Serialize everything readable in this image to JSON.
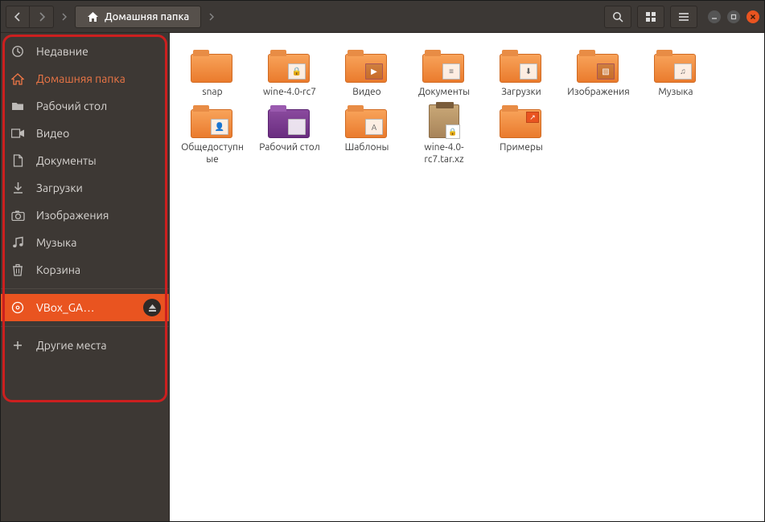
{
  "header": {
    "path_label": "Домашняя папка"
  },
  "sidebar": {
    "items": [
      {
        "icon": "clock",
        "label": "Недавние"
      },
      {
        "icon": "home",
        "label": "Домашняя папка",
        "active": true
      },
      {
        "icon": "folder",
        "label": "Рабочий стол"
      },
      {
        "icon": "video",
        "label": "Видео"
      },
      {
        "icon": "doc",
        "label": "Документы"
      },
      {
        "icon": "download",
        "label": "Загрузки"
      },
      {
        "icon": "camera",
        "label": "Изображения"
      },
      {
        "icon": "music",
        "label": "Музыка"
      },
      {
        "icon": "trash",
        "label": "Корзина"
      }
    ],
    "devices": [
      {
        "icon": "disc",
        "label": "VBox_GA…",
        "selected": true,
        "ejectable": true
      }
    ],
    "other": [
      {
        "icon": "plus",
        "label": "Другие места"
      }
    ]
  },
  "content": {
    "row1": [
      {
        "type": "folder",
        "label": "snap"
      },
      {
        "type": "folder",
        "label": "wine-4.0-rc7",
        "emblem": "lock"
      },
      {
        "type": "folder",
        "label": "Видео",
        "emblem": "video",
        "dark": true
      },
      {
        "type": "folder",
        "label": "Документы",
        "emblem": "doc"
      },
      {
        "type": "folder",
        "label": "Загрузки",
        "emblem": "download"
      },
      {
        "type": "folder",
        "label": "Изображения",
        "emblem": "image",
        "dark": true
      },
      {
        "type": "folder",
        "label": "Музыка",
        "emblem": "music"
      }
    ],
    "row2": [
      {
        "type": "folder",
        "label": "Общедоступные",
        "emblem": "person"
      },
      {
        "type": "folder",
        "label": "Рабочий стол",
        "purple": true,
        "emblem": "blank"
      },
      {
        "type": "folder",
        "label": "Шаблоны",
        "emblem": "template"
      },
      {
        "type": "archive",
        "label": "wine-4.0-rc7.tar.xz",
        "emblem": "lock"
      },
      {
        "type": "folder",
        "label": "Примеры",
        "shortcut": true
      }
    ]
  }
}
